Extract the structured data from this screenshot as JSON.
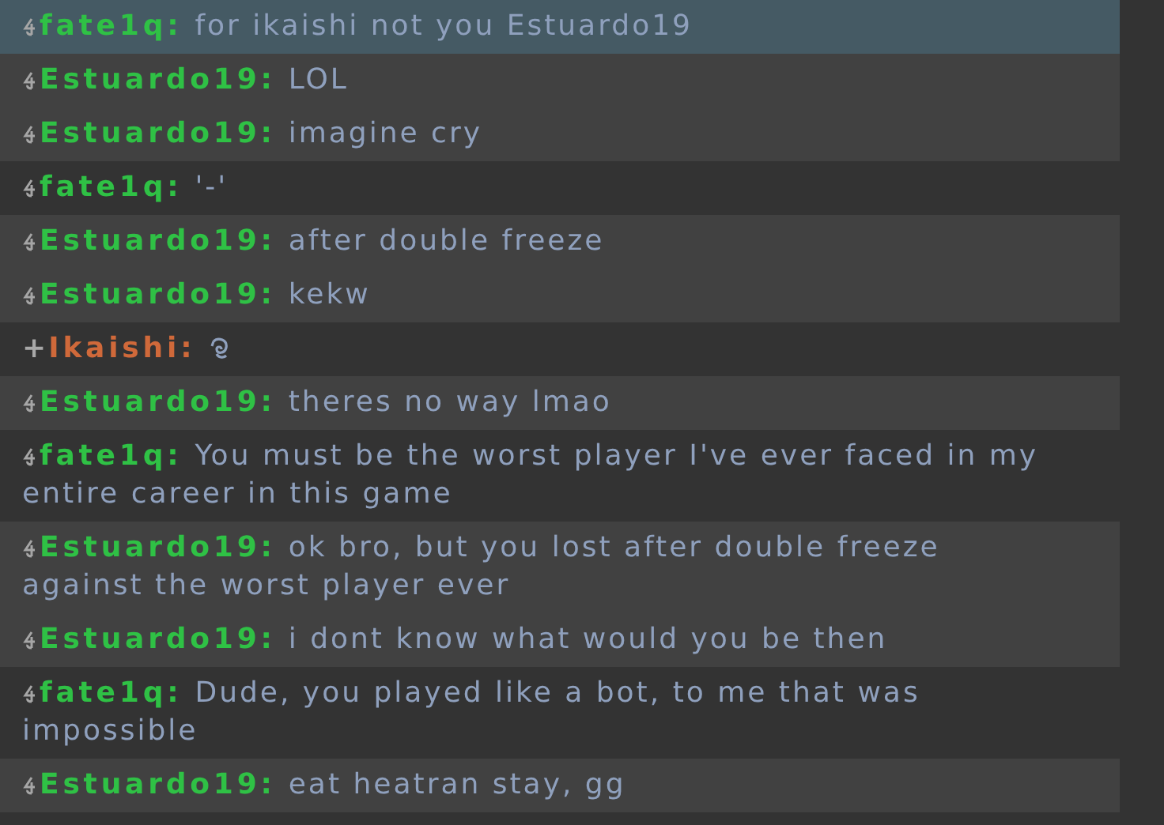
{
  "chat": {
    "groups": [
      {
        "highlighted": true,
        "messages": [
          {
            "user": "fate1q:",
            "color": "#2fc145",
            "kind": "text",
            "lines": [
              "for ikaishi not you Estuardo19"
            ]
          }
        ]
      },
      {
        "highlighted": false,
        "messages": [
          {
            "user": "Estuardo19:",
            "color": "#2fc145",
            "kind": "text",
            "lines": [
              "LOL"
            ]
          },
          {
            "user": "Estuardo19:",
            "color": "#2fc145",
            "kind": "text",
            "lines": [
              "imagine cry"
            ]
          }
        ]
      },
      {
        "highlighted": false,
        "messages": [
          {
            "user": "fate1q:",
            "color": "#2fc145",
            "kind": "text",
            "lines": [
              "'-'"
            ]
          }
        ]
      },
      {
        "highlighted": false,
        "messages": [
          {
            "user": "Estuardo19:",
            "color": "#2fc145",
            "kind": "text",
            "lines": [
              "after double freeze"
            ]
          },
          {
            "user": "Estuardo19:",
            "color": "#2fc145",
            "kind": "text",
            "lines": [
              "kekw"
            ]
          }
        ]
      },
      {
        "highlighted": false,
        "messages": [
          {
            "rank": "+",
            "user": "Ikaishi:",
            "color": "#d0693a",
            "kind": "emoji"
          }
        ]
      },
      {
        "highlighted": false,
        "messages": [
          {
            "user": "Estuardo19:",
            "color": "#2fc145",
            "kind": "text",
            "lines": [
              "theres no way lmao"
            ]
          }
        ]
      },
      {
        "highlighted": false,
        "messages": [
          {
            "user": "fate1q:",
            "color": "#2fc145",
            "kind": "text",
            "lines": [
              "You must be the worst player I've ever faced in my",
              "entire career in this game"
            ]
          }
        ]
      },
      {
        "highlighted": false,
        "messages": [
          {
            "user": "Estuardo19:",
            "color": "#2fc145",
            "kind": "text",
            "lines": [
              "ok bro, but you lost after double freeze",
              "against the worst player ever"
            ]
          },
          {
            "user": "Estuardo19:",
            "color": "#2fc145",
            "kind": "text",
            "lines": [
              "i dont know what would you be then"
            ]
          }
        ]
      },
      {
        "highlighted": false,
        "messages": [
          {
            "user": "fate1q:",
            "color": "#2fc145",
            "kind": "text",
            "lines": [
              "Dude, you played like a bot, to me that was",
              "impossible"
            ]
          }
        ]
      },
      {
        "highlighted": false,
        "messages": [
          {
            "user": "Estuardo19:",
            "color": "#2fc145",
            "kind": "text",
            "lines": [
              "eat heatran stay, gg"
            ]
          }
        ]
      }
    ]
  }
}
